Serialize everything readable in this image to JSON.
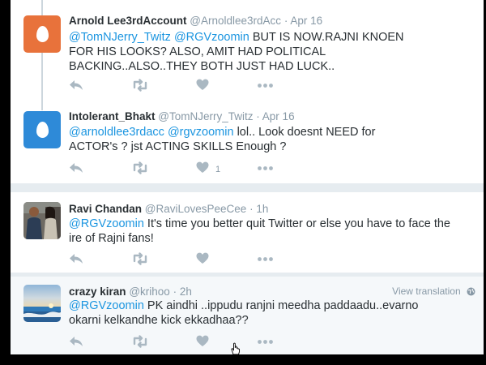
{
  "tweets": [
    {
      "name": "Arnold Lee3rdAccount",
      "handle": "@Arnoldlee3rdAcc",
      "sep": "·",
      "time": "Apr 16",
      "body": [
        {
          "m": "@TomNJerry_Twitz"
        },
        {
          "t": " "
        },
        {
          "m": "@RGVzoomin"
        },
        {
          "t": " BUT IS NOW.RAJNI KNOEN FOR HIS LOOKS? ALSO, AMIT HAD POLITICAL BACKING..ALSO..THEY BOTH JUST HAD LUCK.."
        }
      ],
      "avatar": "default-egg-avatar-orange",
      "avatar_color": "#e8723b"
    },
    {
      "name": "Intolerant_Bhakt",
      "handle": "@TomNJerry_Twitz",
      "sep": "·",
      "time": "Apr 16",
      "body": [
        {
          "m": "@arnoldlee3rdacc"
        },
        {
          "t": " "
        },
        {
          "m": "@rgvzoomin"
        },
        {
          "t": " lol.. Look doesnt NEED for ACTOR's ? jst ACTING SKILLS Enough ?"
        }
      ],
      "avatar": "default-egg-avatar-blue",
      "avatar_color": "#2e8ad8",
      "likes": "1"
    },
    {
      "name": "Ravi Chandan",
      "handle": "@RaviLovesPeeCee",
      "sep": "·",
      "time": "1h",
      "body": [
        {
          "m": "@RGVzoomin"
        },
        {
          "t": " It's time you better quit Twitter or else you have to face the ire of Rajni fans!"
        }
      ],
      "avatar": "couple-photo-avatar"
    },
    {
      "name": "crazy kiran",
      "handle": "@krihoo",
      "sep": "·",
      "time": "2h",
      "view_translation": "View translation",
      "body": [
        {
          "m": "@RGVzoomin"
        },
        {
          "t": " PK aindhi ..ippudu ranjni meedha paddaadu..evarno okarni kelkandhe kick ekkadhaa??"
        }
      ],
      "avatar": "beach-sunset-avatar"
    }
  ],
  "icons": {
    "reply": "reply-icon",
    "retweet": "retweet-icon",
    "like": "heart-icon",
    "more": "more-dots-icon",
    "globe": "globe-icon"
  },
  "colors": {
    "link": "#1b95e0",
    "muted": "#8899a6",
    "action_icon": "#aab8c2",
    "text": "#292f33"
  }
}
